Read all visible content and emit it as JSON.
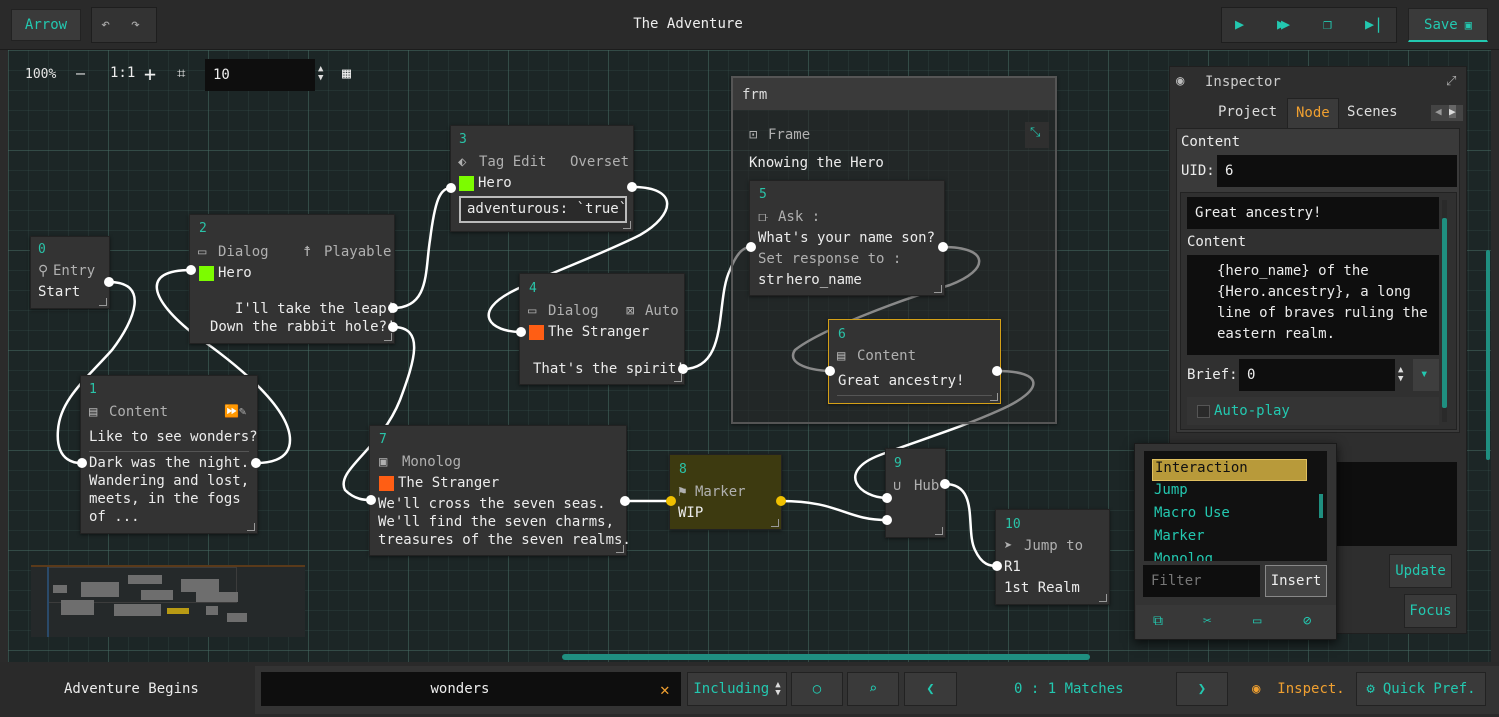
{
  "toolbar": {
    "mode": "Arrow",
    "title": "The Adventure",
    "save": "Save"
  },
  "canvas_tools": {
    "zoom": "100%",
    "reset": "1:1",
    "grid": "10"
  },
  "nodes": {
    "n0": {
      "id": "0",
      "type": "Entry",
      "text": "Start"
    },
    "n1": {
      "id": "1",
      "type": "Content",
      "line1": "Like to see wonders?",
      "body": [
        "Dark was the night.",
        "Wandering and lost,",
        "meets, in the fogs",
        "of ..."
      ]
    },
    "n2": {
      "id": "2",
      "type": "Dialog",
      "flag": "Playable",
      "char": "Hero",
      "o1": "I'll take the leap!",
      "o2": "Down the rabbit hole?!"
    },
    "n3": {
      "id": "3",
      "type": "Tag Edit",
      "flag": "Overset",
      "char": "Hero",
      "tag": "adventurous: `true`"
    },
    "n4": {
      "id": "4",
      "type": "Dialog",
      "flag": "Auto",
      "char": "The Stranger",
      "line": "That's the spirit!"
    },
    "n5": {
      "id": "5",
      "type": "Ask :",
      "q": "What's your name son?",
      "set": "Set response to :",
      "var_type": "str",
      "var": "hero_name"
    },
    "n6": {
      "id": "6",
      "type": "Content",
      "text": "Great ancestry!"
    },
    "n7": {
      "id": "7",
      "type": "Monolog",
      "char": "The Stranger",
      "body": [
        "We'll cross the seven seas.",
        "We'll find the seven charms,",
        "treasures of the seven realms."
      ]
    },
    "n8": {
      "id": "8",
      "type": "Marker",
      "text": "WIP"
    },
    "n9": {
      "id": "9",
      "type": "Hub"
    },
    "n10": {
      "id": "10",
      "type": "Jump to",
      "target": "R1",
      "target_name": "1st Realm"
    },
    "frame": {
      "name": "frm",
      "type": "Frame",
      "label": "Knowing the Hero"
    }
  },
  "inspector": {
    "title": "Inspector",
    "tabs": [
      "Project",
      "Node",
      "Scenes"
    ],
    "section": "Content",
    "uid_label": "UID:",
    "uid": "6",
    "title_value": "Great ancestry!",
    "content_label": "Content",
    "content": [
      "{hero_name} of the",
      "{Hero.ancestry}, a long",
      "line of braves ruling the",
      "eastern realm."
    ],
    "brief_label": "Brief:",
    "brief": "0",
    "autoplay": "Auto-play",
    "update": "Update",
    "focus": "Focus"
  },
  "insert_menu": {
    "items": [
      "Interaction",
      "Jump",
      "Macro Use",
      "Marker",
      "Monolog"
    ],
    "filter_placeholder": "Filter",
    "insert": "Insert"
  },
  "bottom": {
    "scene": "Adventure Begins",
    "search": "wonders",
    "mode": "Including",
    "matches": "0 : 1 Matches",
    "inspect": "Inspect.",
    "quick": "Quick Pref."
  },
  "colors": {
    "accent": "#23c8b0",
    "hero": "#7cfc00",
    "stranger": "#ff5e14",
    "selected": "#d4a017",
    "marker": "#3d3a10"
  }
}
